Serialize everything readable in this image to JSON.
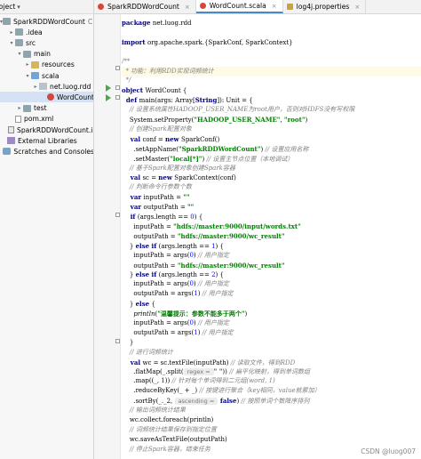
{
  "project_panel": {
    "header_label": "roject",
    "tree": [
      {
        "label": "SparkRDDWordCount",
        "suffix": "C:\\Us",
        "depth": 0,
        "icon": "folder",
        "open": true
      },
      {
        "label": ".idea",
        "depth": 1,
        "icon": "folder",
        "open": false
      },
      {
        "label": "src",
        "depth": 1,
        "icon": "folder",
        "open": true
      },
      {
        "label": "main",
        "depth": 2,
        "icon": "folder",
        "open": true
      },
      {
        "label": "resources",
        "depth": 3,
        "icon": "folder-yellow",
        "open": false
      },
      {
        "label": "scala",
        "depth": 3,
        "icon": "folder-blue",
        "open": true
      },
      {
        "label": "net.luog.rdd",
        "depth": 4,
        "icon": "package",
        "open": false
      },
      {
        "label": "WordCount",
        "depth": 5,
        "icon": "scala-icon",
        "selected": true
      },
      {
        "label": "test",
        "depth": 2,
        "icon": "folder",
        "open": false
      },
      {
        "label": "pom.xml",
        "depth": 1,
        "icon": "file-icon"
      },
      {
        "label": "SparkRDDWordCount.iml",
        "depth": 1,
        "icon": "iml-icon"
      },
      {
        "label": "External Libraries",
        "depth": 0,
        "icon": "library-icon"
      },
      {
        "label": "Scratches and Consoles",
        "depth": 0,
        "icon": "scratch-icon"
      }
    ]
  },
  "tabs": [
    {
      "label": "SparkRDDWordCount",
      "icon": "scala-icon",
      "active": false
    },
    {
      "label": "WordCount.scala",
      "icon": "scala-icon",
      "active": true
    },
    {
      "label": "log4j.properties",
      "icon": "properties-icon",
      "active": false
    }
  ],
  "code_lines": [
    {
      "kind": "pkg",
      "parts": [
        {
          "t": "package ",
          "c": "kw"
        },
        {
          "t": "net.luog.rdd",
          "c": ""
        }
      ]
    },
    {
      "kind": "blank",
      "parts": []
    },
    {
      "kind": "import",
      "parts": [
        {
          "t": "import ",
          "c": "kw"
        },
        {
          "t": "org.apache.spark.{SparkConf, SparkContext}",
          "c": ""
        }
      ]
    },
    {
      "kind": "blank",
      "parts": []
    },
    {
      "kind": "doc",
      "parts": [
        {
          "t": "/**",
          "c": "cm"
        }
      ]
    },
    {
      "kind": "doc",
      "parts": [
        {
          "t": "  * 功能：利用RDD实现词频统计",
          "c": "cm"
        }
      ]
    },
    {
      "kind": "doc",
      "parts": [
        {
          "t": "  */",
          "c": "cm"
        }
      ]
    },
    {
      "kind": "obj",
      "parts": [
        {
          "t": "object ",
          "c": "kw"
        },
        {
          "t": "WordCount {",
          "c": ""
        }
      ]
    },
    {
      "kind": "def",
      "parts": [
        {
          "t": "  def ",
          "c": "kw"
        },
        {
          "t": "main(args: Array[",
          "c": ""
        },
        {
          "t": "String",
          "c": "kw"
        },
        {
          "t": "]): Unit = {",
          "c": ""
        }
      ]
    },
    {
      "kind": "c",
      "parts": [
        {
          "t": "    // 设置系统属性HADOOP_USER_NAME为root用户，否则对HDFS没有写权限",
          "c": "cm"
        }
      ]
    },
    {
      "kind": "c",
      "parts": [
        {
          "t": "    System.setProperty(",
          "c": ""
        },
        {
          "t": "\"HADOOP_USER_NAME\"",
          "c": "str"
        },
        {
          "t": ", ",
          "c": ""
        },
        {
          "t": "\"root\"",
          "c": "str"
        },
        {
          "t": ")",
          "c": ""
        }
      ]
    },
    {
      "kind": "c",
      "parts": [
        {
          "t": "    // 创建Spark配置对象",
          "c": "cm"
        }
      ]
    },
    {
      "kind": "c",
      "parts": [
        {
          "t": "    val ",
          "c": "kw"
        },
        {
          "t": "conf = ",
          "c": ""
        },
        {
          "t": "new ",
          "c": "kw"
        },
        {
          "t": "SparkConf()",
          "c": ""
        }
      ]
    },
    {
      "kind": "c",
      "parts": [
        {
          "t": "      .setAppName(",
          "c": ""
        },
        {
          "t": "\"SparkRDDWordCount\"",
          "c": "str"
        },
        {
          "t": ") ",
          "c": ""
        },
        {
          "t": "// 设置应用名称",
          "c": "cm"
        }
      ]
    },
    {
      "kind": "c",
      "parts": [
        {
          "t": "      .setMaster(",
          "c": ""
        },
        {
          "t": "\"local[*]\"",
          "c": "str"
        },
        {
          "t": ") ",
          "c": ""
        },
        {
          "t": "// 设置主节点位置（本地调试）",
          "c": "cm"
        }
      ]
    },
    {
      "kind": "c",
      "parts": [
        {
          "t": "    // 基于Spark配置对象创建Spark容器",
          "c": "cm"
        }
      ]
    },
    {
      "kind": "c",
      "parts": [
        {
          "t": "    val ",
          "c": "kw"
        },
        {
          "t": "sc = ",
          "c": ""
        },
        {
          "t": "new ",
          "c": "kw"
        },
        {
          "t": "SparkContext(conf)",
          "c": ""
        }
      ]
    },
    {
      "kind": "c",
      "parts": [
        {
          "t": "    // 判断命令行参数个数",
          "c": "cm"
        }
      ]
    },
    {
      "kind": "c",
      "parts": [
        {
          "t": "    var ",
          "c": "kw"
        },
        {
          "t": "inputPath = ",
          "c": ""
        },
        {
          "t": "\"\"",
          "c": "str"
        }
      ]
    },
    {
      "kind": "c",
      "parts": [
        {
          "t": "    var ",
          "c": "kw"
        },
        {
          "t": "outputPath = ",
          "c": ""
        },
        {
          "t": "\"\"",
          "c": "str"
        }
      ]
    },
    {
      "kind": "c",
      "parts": [
        {
          "t": "    if ",
          "c": "kw"
        },
        {
          "t": "(args.length == ",
          "c": ""
        },
        {
          "t": "0",
          "c": "num"
        },
        {
          "t": ") {",
          "c": ""
        }
      ]
    },
    {
      "kind": "c",
      "parts": [
        {
          "t": "      inputPath = ",
          "c": ""
        },
        {
          "t": "\"hdfs://master:9000/input/words.txt\"",
          "c": "str"
        }
      ]
    },
    {
      "kind": "c",
      "parts": [
        {
          "t": "      outputPath = ",
          "c": ""
        },
        {
          "t": "\"hdfs://master:9000/wc_result\"",
          "c": "str"
        }
      ]
    },
    {
      "kind": "c",
      "parts": [
        {
          "t": "    } ",
          "c": ""
        },
        {
          "t": "else if ",
          "c": "kw"
        },
        {
          "t": "(args.length == ",
          "c": ""
        },
        {
          "t": "1",
          "c": "num"
        },
        {
          "t": ") {",
          "c": ""
        }
      ]
    },
    {
      "kind": "c",
      "parts": [
        {
          "t": "      inputPath = args(",
          "c": ""
        },
        {
          "t": "0",
          "c": "num"
        },
        {
          "t": ") ",
          "c": ""
        },
        {
          "t": "// 用户指定",
          "c": "cm"
        }
      ]
    },
    {
      "kind": "c",
      "parts": [
        {
          "t": "      outputPath = ",
          "c": ""
        },
        {
          "t": "\"hdfs://master:9000/wc_result\"",
          "c": "str"
        }
      ]
    },
    {
      "kind": "c",
      "parts": [
        {
          "t": "    } ",
          "c": ""
        },
        {
          "t": "else if ",
          "c": "kw"
        },
        {
          "t": "(args.length == ",
          "c": ""
        },
        {
          "t": "2",
          "c": "num"
        },
        {
          "t": ") {",
          "c": ""
        }
      ]
    },
    {
      "kind": "c",
      "parts": [
        {
          "t": "      inputPath = args(",
          "c": ""
        },
        {
          "t": "0",
          "c": "num"
        },
        {
          "t": ") ",
          "c": ""
        },
        {
          "t": "// 用户指定",
          "c": "cm"
        }
      ]
    },
    {
      "kind": "c",
      "parts": [
        {
          "t": "      outputPath = args(",
          "c": ""
        },
        {
          "t": "1",
          "c": "num"
        },
        {
          "t": ") ",
          "c": ""
        },
        {
          "t": "// 用户指定",
          "c": "cm"
        }
      ]
    },
    {
      "kind": "c",
      "parts": [
        {
          "t": "    } ",
          "c": ""
        },
        {
          "t": "else ",
          "c": "kw"
        },
        {
          "t": "{",
          "c": ""
        }
      ]
    },
    {
      "kind": "c",
      "parts": [
        {
          "t": "      println",
          "c": "fn"
        },
        {
          "t": "(",
          "c": ""
        },
        {
          "t": "\"温馨提示：参数不能多于两个\"",
          "c": "str"
        },
        {
          "t": ")",
          "c": ""
        }
      ]
    },
    {
      "kind": "c",
      "parts": [
        {
          "t": "      inputPath = args(",
          "c": ""
        },
        {
          "t": "0",
          "c": "num"
        },
        {
          "t": ") ",
          "c": ""
        },
        {
          "t": "// 用户指定",
          "c": "cm"
        }
      ]
    },
    {
      "kind": "c",
      "parts": [
        {
          "t": "      outputPath = args(",
          "c": ""
        },
        {
          "t": "1",
          "c": "num"
        },
        {
          "t": ") ",
          "c": ""
        },
        {
          "t": "// 用户指定",
          "c": "cm"
        }
      ]
    },
    {
      "kind": "c",
      "parts": [
        {
          "t": "    }",
          "c": ""
        }
      ]
    },
    {
      "kind": "c",
      "parts": [
        {
          "t": "    // 进行词频统计",
          "c": "cm"
        }
      ]
    },
    {
      "kind": "c",
      "parts": [
        {
          "t": "    val ",
          "c": "kw"
        },
        {
          "t": "wc = sc.textFile(inputPath) ",
          "c": ""
        },
        {
          "t": "// 读取文件，得到RDD",
          "c": "cm"
        }
      ]
    },
    {
      "kind": "c",
      "parts": [
        {
          "t": "      .flatMap(_.split(",
          "c": ""
        },
        {
          "t": " regex = ",
          "c": "hint"
        },
        {
          "t": "\" \"",
          "c": "str"
        },
        {
          "t": ")) ",
          "c": ""
        },
        {
          "t": "// 扁平化映射，得到单词数组",
          "c": "cm"
        }
      ]
    },
    {
      "kind": "c",
      "parts": [
        {
          "t": "      .map((_, ",
          "c": ""
        },
        {
          "t": "1",
          "c": "num"
        },
        {
          "t": ")) ",
          "c": ""
        },
        {
          "t": "// 针对每个单词得到二元组(word, 1)",
          "c": "cm"
        }
      ]
    },
    {
      "kind": "c",
      "parts": [
        {
          "t": "      .reduceByKey(_ + _) ",
          "c": ""
        },
        {
          "t": "// 按键进行聚合（key相同，value就累加）",
          "c": "cm"
        }
      ]
    },
    {
      "kind": "c",
      "parts": [
        {
          "t": "      .sortBy(_._2, ",
          "c": ""
        },
        {
          "t": " ascending = ",
          "c": "hint"
        },
        {
          "t": " false",
          "c": "kw"
        },
        {
          "t": ") ",
          "c": ""
        },
        {
          "t": "// 按照单词个数降序排列",
          "c": "cm"
        }
      ]
    },
    {
      "kind": "c",
      "parts": [
        {
          "t": "    // 输出词频统计结果",
          "c": "cm"
        }
      ]
    },
    {
      "kind": "c",
      "parts": [
        {
          "t": "    wc.collect.foreach(println)",
          "c": ""
        }
      ]
    },
    {
      "kind": "c",
      "parts": [
        {
          "t": "    // 词频统计结果保存到指定位置",
          "c": "cm"
        }
      ]
    },
    {
      "kind": "c",
      "parts": [
        {
          "t": "    wc.saveAsTextFile(outputPath)",
          "c": ""
        }
      ]
    },
    {
      "kind": "c",
      "parts": [
        {
          "t": "    // 停止Spark容器，结束任务",
          "c": "cm"
        }
      ]
    }
  ],
  "watermark": "CSDN @luog007"
}
